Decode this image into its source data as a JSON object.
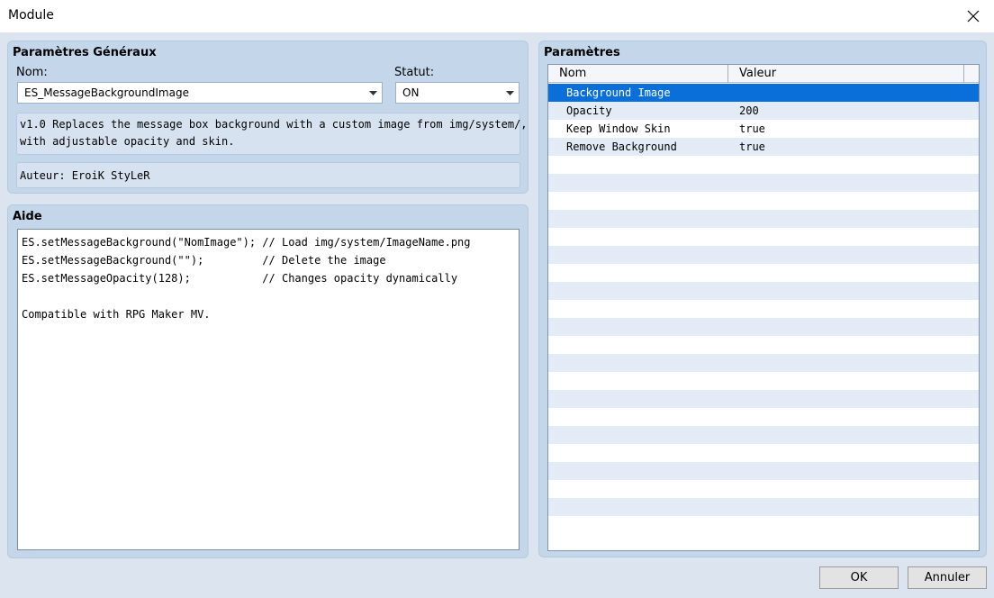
{
  "window": {
    "title": "Module"
  },
  "general": {
    "title": "Paramètres Généraux",
    "name_label": "Nom:",
    "name_value": "ES_MessageBackgroundImage",
    "status_label": "Statut:",
    "status_value": "ON",
    "description": "v1.0 Replaces the message box background with a custom image from img/system/,\nwith adjustable opacity and skin.",
    "author": "Auteur: EroiK StyLeR"
  },
  "help": {
    "title": "Aide",
    "text": "ES.setMessageBackground(\"NomImage\"); // Load img/system/ImageName.png\nES.setMessageBackground(\"\");         // Delete the image\nES.setMessageOpacity(128);           // Changes opacity dynamically\n\nCompatible with RPG Maker MV."
  },
  "params": {
    "title": "Paramètres",
    "columns": [
      "Nom",
      "Valeur"
    ],
    "rows": [
      {
        "name": "Background Image",
        "value": ""
      },
      {
        "name": "Opacity",
        "value": "200"
      },
      {
        "name": "Keep Window Skin",
        "value": "true"
      },
      {
        "name": "Remove Background",
        "value": "true"
      }
    ],
    "selected_index": 0,
    "empty_rows": 21
  },
  "buttons": {
    "ok": "OK",
    "cancel": "Annuler"
  },
  "colors": {
    "selection": "#0a6fd8",
    "group_bg": "#c4d6ea",
    "client_bg": "#dbe4ef"
  }
}
